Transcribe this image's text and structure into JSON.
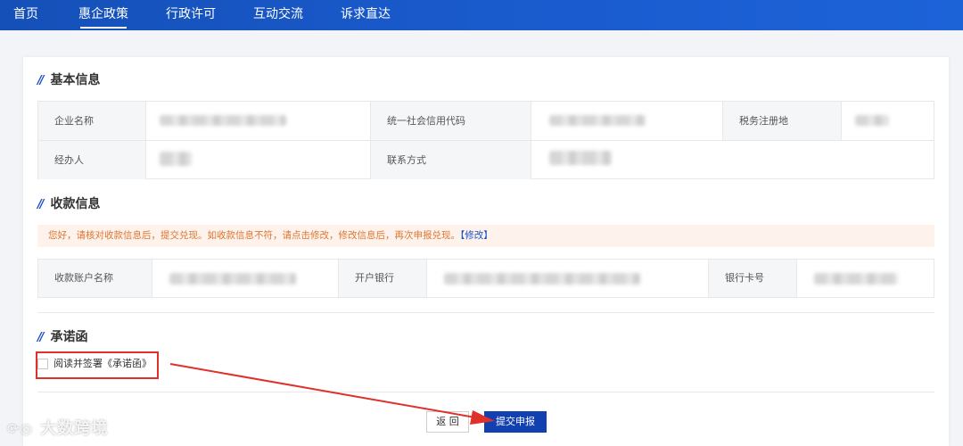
{
  "nav": {
    "items": [
      {
        "label": "首页"
      },
      {
        "label": "惠企政策"
      },
      {
        "label": "行政许可"
      },
      {
        "label": "互动交流"
      },
      {
        "label": "诉求直达"
      }
    ],
    "active": "惠企政策"
  },
  "basic_info": {
    "title": "基本信息",
    "company_name_label": "企业名称",
    "credit_code_label": "统一社会信用代码",
    "tax_place_label": "税务注册地",
    "handler_label": "经办人",
    "contact_label": "联系方式"
  },
  "payment_info": {
    "title": "收款信息",
    "notice_text": "您好，请核对收款信息后，提交兑现。如收款信息不符，请点击修改，修改信息后，再次申报兑现。",
    "edit_link": "【修改】",
    "account_name_label": "收款账户名称",
    "bank_label": "开户银行",
    "card_label": "银行卡号"
  },
  "commitment": {
    "title": "承诺函",
    "checkbox_label": "阅读并签署《承诺函》",
    "checked": false
  },
  "actions": {
    "back_label": "返 回",
    "submit_label": "提交申报"
  },
  "watermark": {
    "text": "大数跨境"
  },
  "colors": {
    "nav_bg": "#1a5cd0",
    "accent": "#1a4fc4",
    "submit_bg": "#1240b0",
    "notice_bg": "#fdf3ec",
    "notice_text": "#e07530",
    "highlight_red": "#e0302a"
  }
}
